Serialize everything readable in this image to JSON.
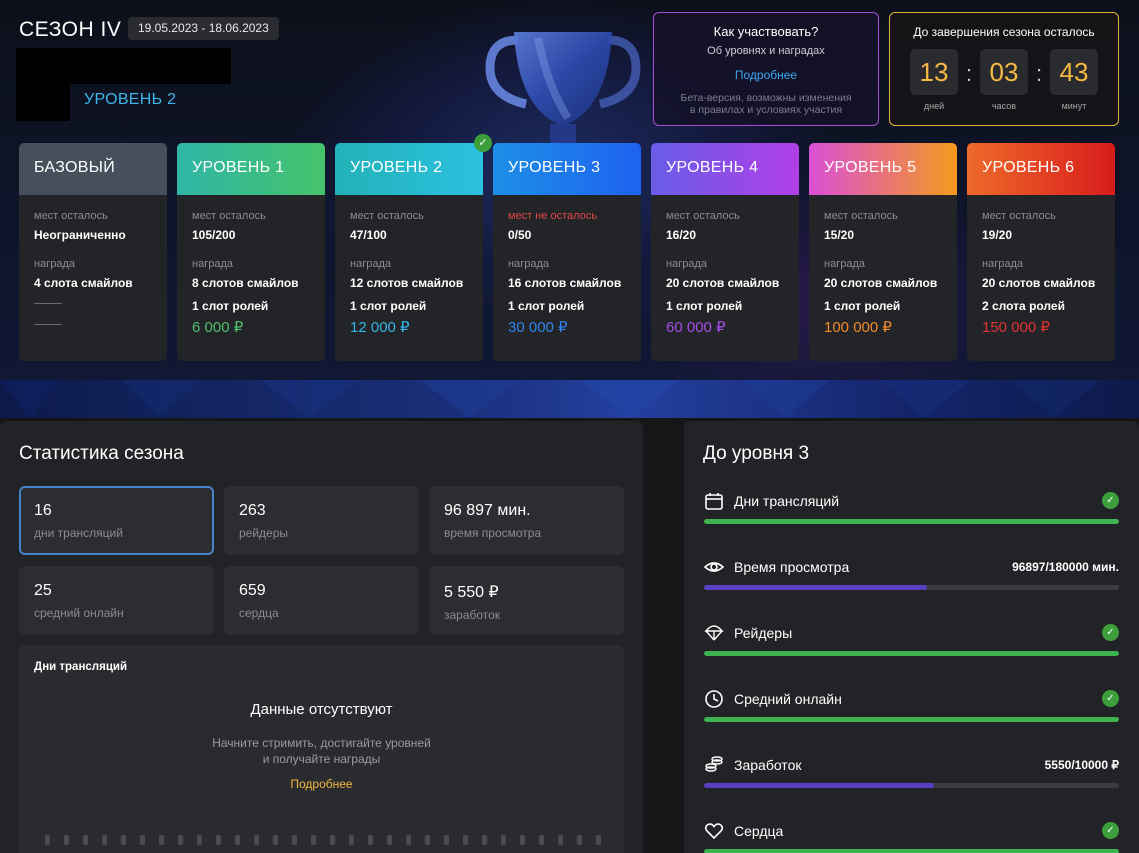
{
  "season": {
    "title": "СЕЗОН IV",
    "dates": "19.05.2023 - 18.06.2023",
    "user_level": "УРОВЕНЬ 2"
  },
  "how": {
    "title": "Как участвовать?",
    "subtitle": "Об уровнях и наградах",
    "link": "Подробнее",
    "note_line1": "Бета-версия, возможны изменения",
    "note_line2": "в правилах и условиях участия"
  },
  "timer": {
    "title": "До завершения сезона осталось",
    "days": "13",
    "days_label": "дней",
    "hours": "03",
    "hours_label": "часов",
    "minutes": "43",
    "minutes_label": "минут"
  },
  "card_labels": {
    "places": "мест осталось",
    "reward": "награда"
  },
  "levels": [
    {
      "name": "БАЗОВЫЙ",
      "places": "Неограниченно",
      "reward1": "4 слота смайлов",
      "reward2": "",
      "price": "",
      "color": "#45505c"
    },
    {
      "name": "УРОВЕНЬ 1",
      "places": "105/200",
      "reward1": "8 слотов смайлов",
      "reward2": "1 слот ролей",
      "price": "6 000 ₽",
      "color": "#3bb37a",
      "price_color": "#4fc06f"
    },
    {
      "name": "УРОВЕНЬ 2",
      "places": "47/100",
      "reward1": "12 слотов смайлов",
      "reward2": "1 слот ролей",
      "price": "12 000 ₽",
      "color": "#23b7c7",
      "price_color": "#35b6e8"
    },
    {
      "name": "УРОВЕНЬ 3",
      "places": "0/50",
      "places_status": "мест не осталось",
      "reward1": "16 слотов смайлов",
      "reward2": "1 слот ролей",
      "price": "30 000 ₽",
      "color": "#1c7be8",
      "price_color": "#2f84f0"
    },
    {
      "name": "УРОВЕНЬ 4",
      "places": "16/20",
      "reward1": "20 слотов смайлов",
      "reward2": "1 слот ролей",
      "price": "60 000 ₽",
      "color": "#8a4de6",
      "price_color": "#a44ee8"
    },
    {
      "name": "УРОВЕНЬ 5",
      "places": "15/20",
      "reward1": "20 слотов смайлов",
      "reward2": "1 слот ролей",
      "price": "100 000 ₽",
      "color": "#f07f2a",
      "price_color": "#f08c2a"
    },
    {
      "name": "УРОВЕНЬ 6",
      "places": "19/20",
      "reward1": "20 слотов смайлов",
      "reward2": "2 слота ролей",
      "price": "150 000 ₽",
      "color": "#e02a2a",
      "price_color": "#e03232"
    }
  ],
  "stats": {
    "title": "Статистика сезона",
    "items": [
      {
        "value": "16",
        "label": "дни трансляций"
      },
      {
        "value": "263",
        "label": "рейдеры"
      },
      {
        "value": "96 897 мин.",
        "label": "время просмотра"
      },
      {
        "value": "25",
        "label": "средний онлайн"
      },
      {
        "value": "659",
        "label": "сердца"
      },
      {
        "value": "5 550 ₽",
        "label": "заработок"
      }
    ],
    "chart": {
      "title": "Дни трансляций",
      "empty_title": "Данные отсутствуют",
      "empty_line1": "Начните стримить, достигайте уровней",
      "empty_line2": "и получайте награды",
      "link": "Подробнее"
    }
  },
  "progress": {
    "title": "До уровня 3",
    "items": [
      {
        "label": "Дни трансляций",
        "icon": "calendar-icon",
        "done": true,
        "value": "",
        "fraction": 1.0
      },
      {
        "label": "Время просмотра",
        "icon": "eye-icon",
        "done": false,
        "value": "96897/180000 мин.",
        "fraction": 0.538
      },
      {
        "label": "Рейдеры",
        "icon": "parachute-icon",
        "done": true,
        "value": "",
        "fraction": 1.0
      },
      {
        "label": "Средний онлайн",
        "icon": "clock-icon",
        "done": true,
        "value": "",
        "fraction": 1.0
      },
      {
        "label": "Заработок",
        "icon": "coins-icon",
        "done": false,
        "value": "5550/10000 ₽",
        "fraction": 0.555
      },
      {
        "label": "Сердца",
        "icon": "heart-icon",
        "done": true,
        "value": "",
        "fraction": 1.0
      }
    ],
    "done_color": "#3fb34f",
    "partial_color": "#5a3fc4"
  }
}
